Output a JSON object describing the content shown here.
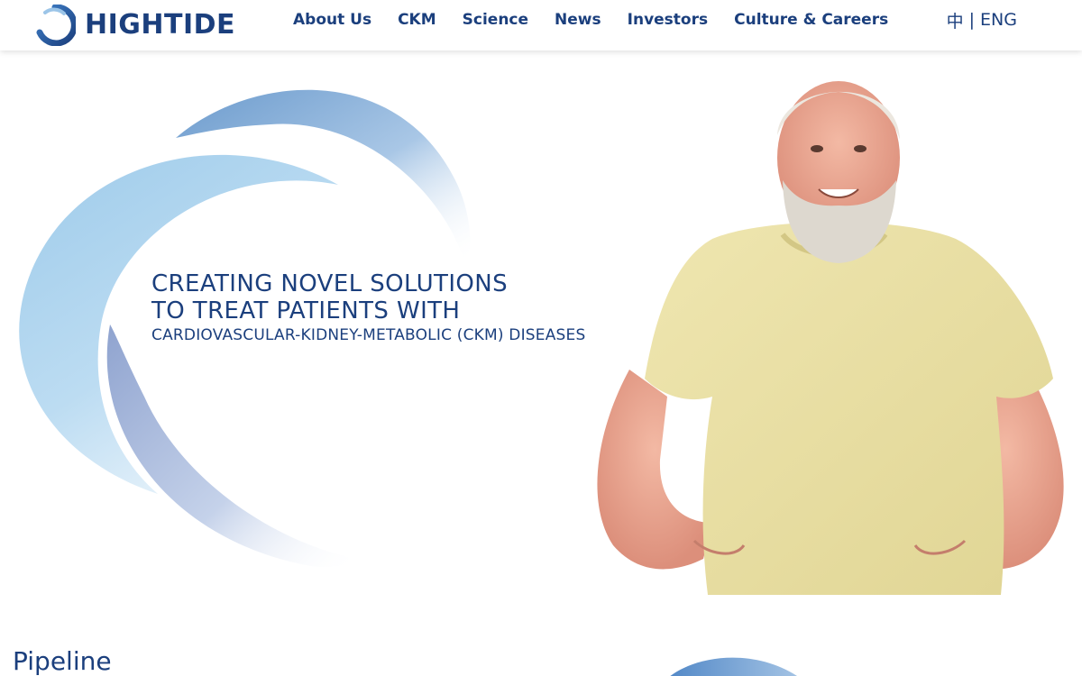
{
  "brand": {
    "name": "HIGHTIDE",
    "color": "#1b3f7d",
    "accent": "#2f67b3"
  },
  "nav": {
    "items": [
      {
        "label": "About Us"
      },
      {
        "label": "CKM"
      },
      {
        "label": "Science"
      },
      {
        "label": "News"
      },
      {
        "label": "Investors"
      },
      {
        "label": "Culture & Careers"
      }
    ]
  },
  "lang": {
    "chinese": "中",
    "separator": "|",
    "english": "ENG"
  },
  "hero": {
    "headline_line1": "CREATING NOVEL SOLUTIONS",
    "headline_line2": "TO TREAT PATIENTS WITH",
    "subline": "CARDIOVASCULAR-KIDNEY-METABOLIC (CKM) DISEASES",
    "photo": "smiling-bearded-man-photo"
  },
  "pipeline": {
    "title": "Pipeline"
  }
}
